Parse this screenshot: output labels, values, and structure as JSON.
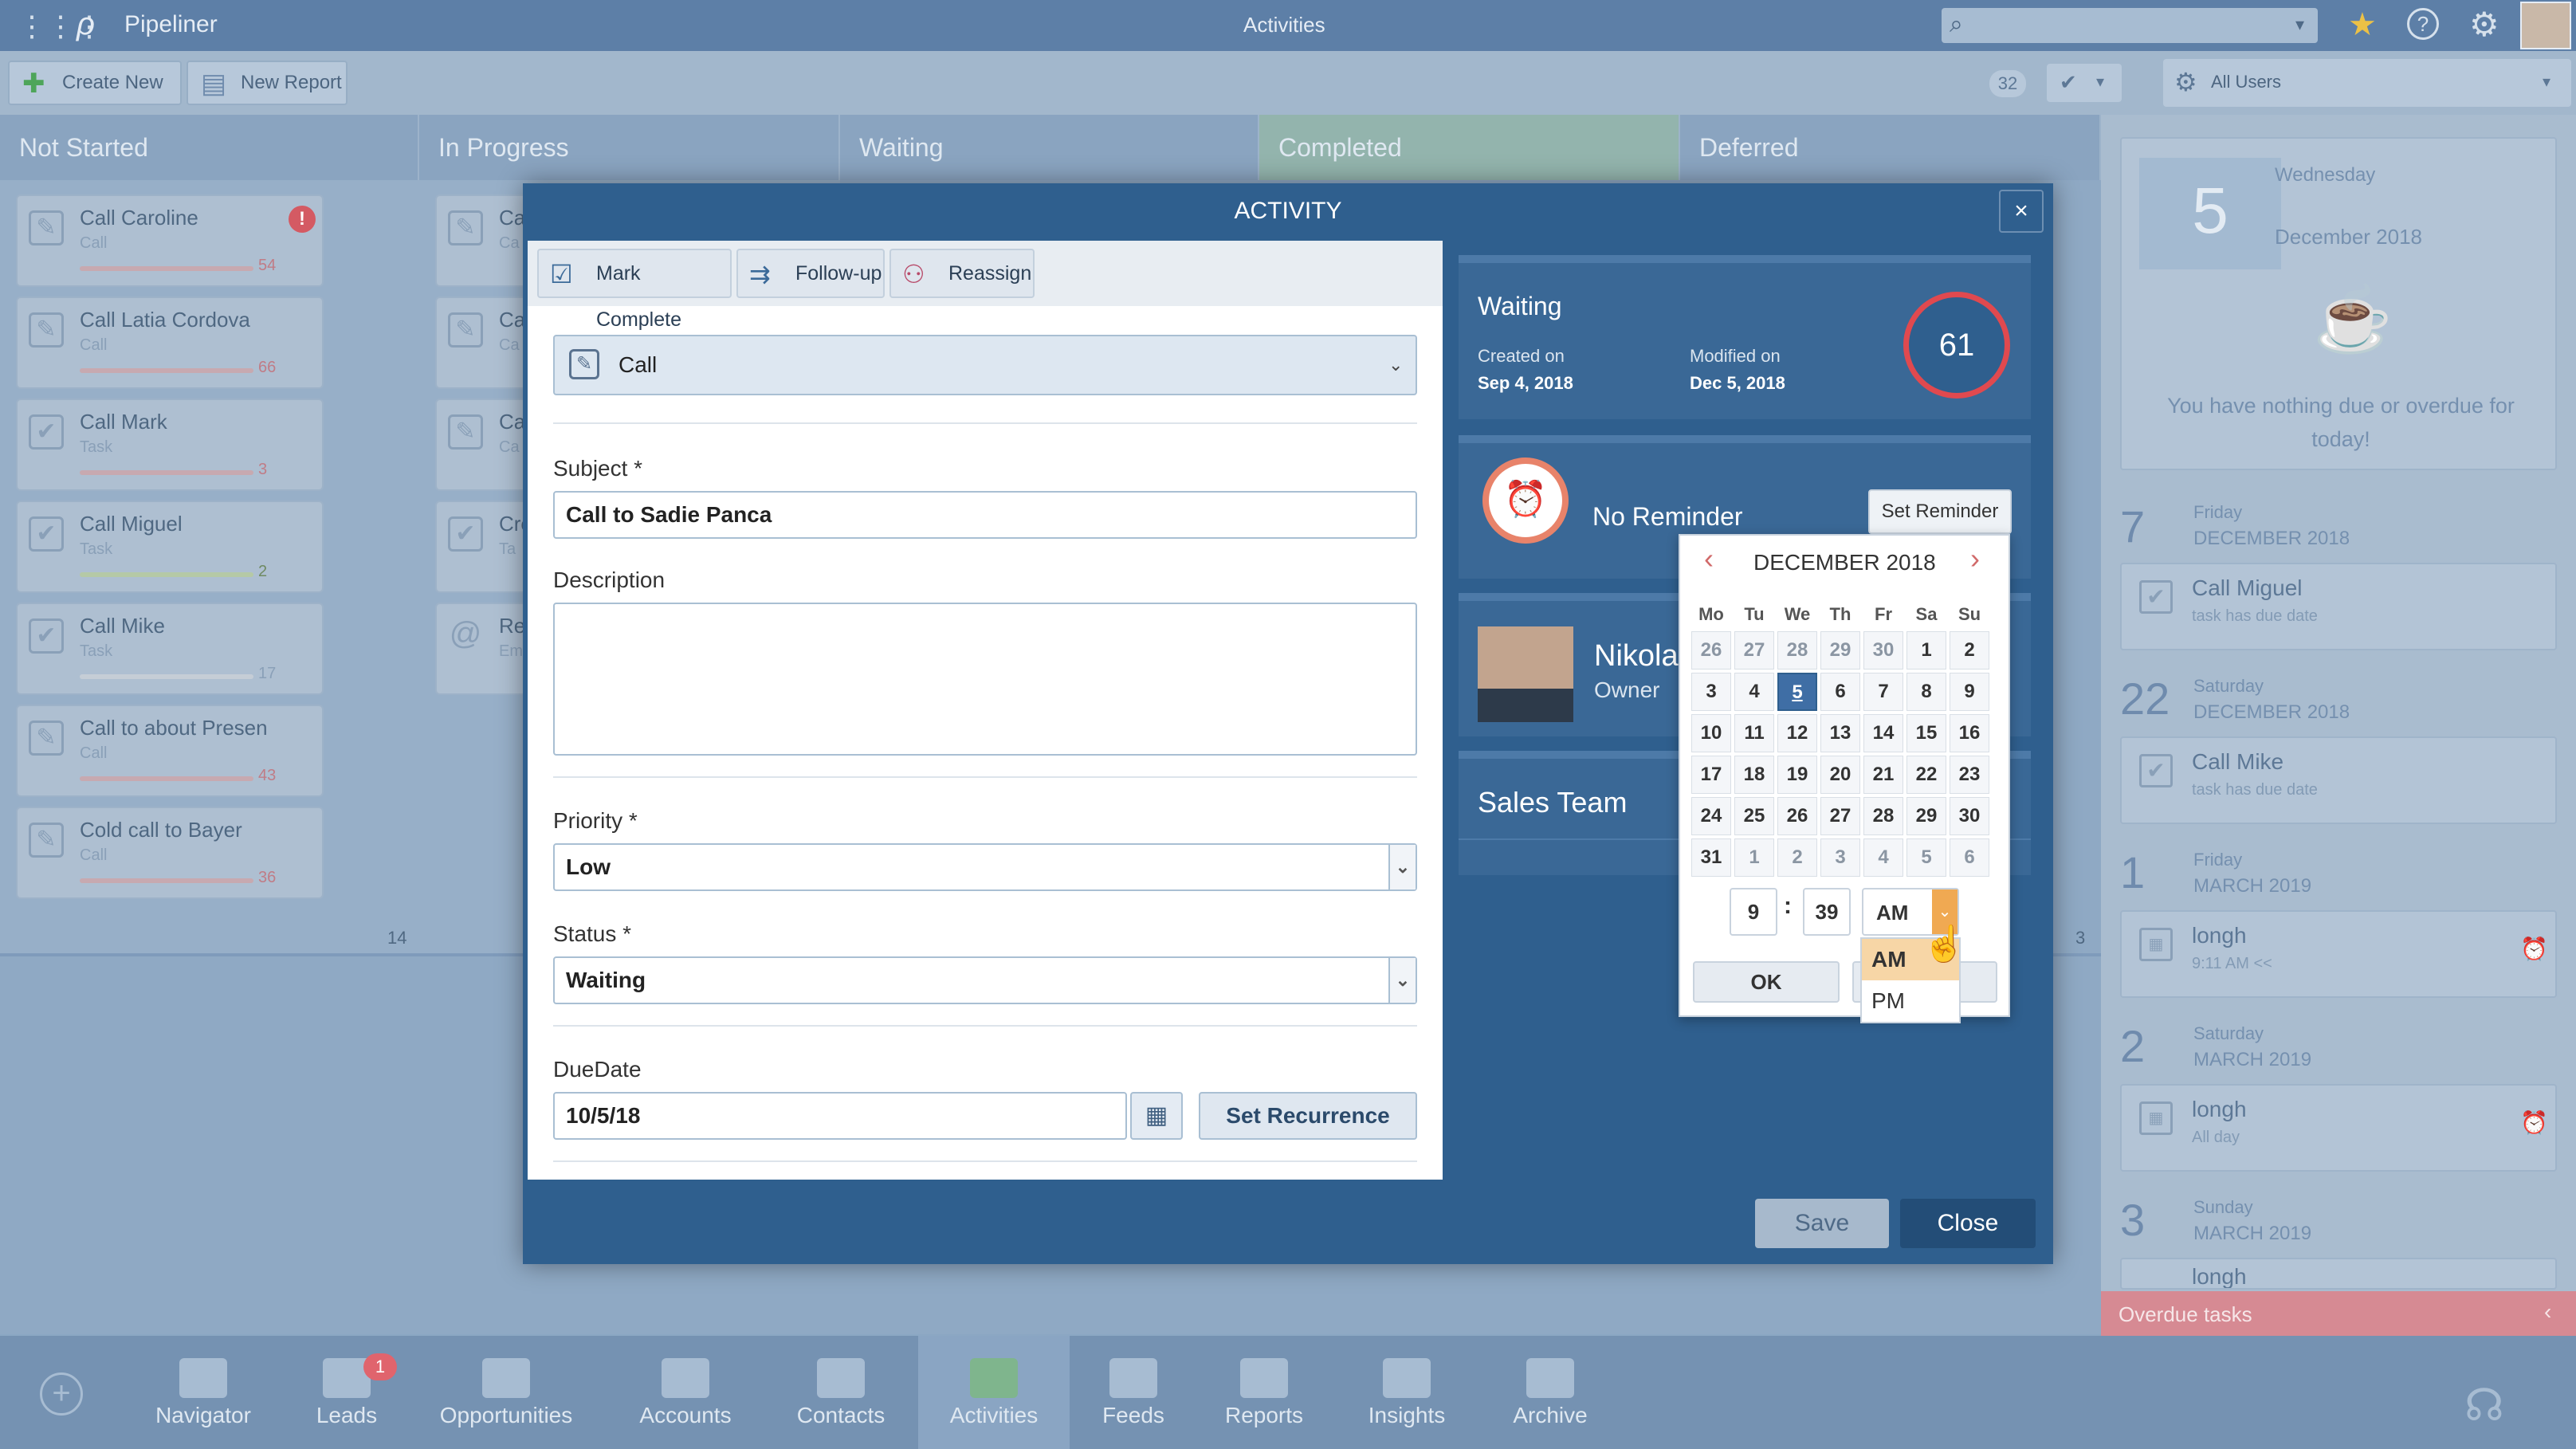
{
  "topbar": {
    "brand": "Pipeliner",
    "title": "Activities"
  },
  "toolbar": {
    "create_new": "Create New",
    "new_report": "New Report",
    "count": "32",
    "users_filter": "All Users"
  },
  "columns": [
    {
      "label": "Not Started"
    },
    {
      "label": "In Progress"
    },
    {
      "label": "Waiting"
    },
    {
      "label": "Completed"
    },
    {
      "label": "Deferred"
    }
  ],
  "not_started_cards": [
    {
      "title": "Call Caroline",
      "type": "Call",
      "num": "54"
    },
    {
      "title": "Call Latia Cordova",
      "type": "Call",
      "num": "66"
    },
    {
      "title": "Call Mark",
      "type": "Task",
      "num": "3"
    },
    {
      "title": "Call Miguel",
      "type": "Task",
      "num": "2"
    },
    {
      "title": "Call Mike",
      "type": "Task",
      "num": "17"
    },
    {
      "title": "Call to about Presen",
      "type": "Call",
      "num": "43"
    },
    {
      "title": "Cold call to Bayer",
      "type": "Call",
      "num": "36"
    }
  ],
  "in_progress_cards": [
    {
      "title": "Ca",
      "type": "Ca"
    },
    {
      "title": "Ca",
      "type": "Ca"
    },
    {
      "title": "Ca",
      "type": "Ca"
    },
    {
      "title": "Cre",
      "type": "Ta"
    },
    {
      "title": "Re",
      "type": "Em"
    }
  ],
  "column_counts": {
    "not_started": "14",
    "deferred": "3"
  },
  "modal": {
    "title": "ACTIVITY",
    "close_x": "×",
    "mark_complete": "Mark Complete",
    "follow_up": "Follow-up",
    "reassign": "Reassign",
    "type_value": "Call",
    "subject_label": "Subject *",
    "subject_value": "Call to Sadie Panca",
    "description_label": "Description",
    "priority_label": "Priority *",
    "priority_value": "Low",
    "status_label": "Status *",
    "status_value": "Waiting",
    "duedate_label": "DueDate",
    "duedate_value": "10/5/18",
    "set_recurrence": "Set Recurrence",
    "save": "Save",
    "close": "Close"
  },
  "status_panel": {
    "status": "Waiting",
    "created_label": "Created on",
    "created_value": "Sep 4, 2018",
    "modified_label": "Modified on",
    "modified_value": "Dec 5, 2018",
    "score": "61"
  },
  "reminder_panel": {
    "label": "No Reminder",
    "button": "Set Reminder"
  },
  "owner_panel": {
    "name": "Nikolau",
    "role": "Owner"
  },
  "team_panel": {
    "label": "Sales Team"
  },
  "calendar": {
    "month": "DECEMBER 2018",
    "prev": "‹",
    "next": "›",
    "weekdays": [
      "Mo",
      "Tu",
      "We",
      "Th",
      "Fr",
      "Sa",
      "Su"
    ],
    "weeks": [
      [
        "26",
        "27",
        "28",
        "29",
        "30",
        "1",
        "2"
      ],
      [
        "3",
        "4",
        "5",
        "6",
        "7",
        "8",
        "9"
      ],
      [
        "10",
        "11",
        "12",
        "13",
        "14",
        "15",
        "16"
      ],
      [
        "17",
        "18",
        "19",
        "20",
        "21",
        "22",
        "23"
      ],
      [
        "24",
        "25",
        "26",
        "27",
        "28",
        "29",
        "30"
      ],
      [
        "31",
        "1",
        "2",
        "3",
        "4",
        "5",
        "6"
      ]
    ],
    "selected": "5",
    "hour": "9",
    "minute": "39",
    "ampm": "AM",
    "options": [
      "AM",
      "PM"
    ],
    "ok": "OK"
  },
  "right_panel": {
    "today_num": "5",
    "today_weekday": "Wednesday",
    "today_month": "December 2018",
    "nothing_due": "You have nothing due or overdue for today!",
    "groups": [
      {
        "num": "7",
        "day": "Friday",
        "month": "DECEMBER 2018",
        "title": "Call Miguel",
        "sub": "task has due date"
      },
      {
        "num": "22",
        "day": "Saturday",
        "month": "DECEMBER 2018",
        "title": "Call Mike",
        "sub": "task has due date"
      },
      {
        "num": "1",
        "day": "Friday",
        "month": "MARCH 2019",
        "title": "longh",
        "sub": "9:11 AM <<"
      },
      {
        "num": "2",
        "day": "Saturday",
        "month": "MARCH 2019",
        "title": "longh",
        "sub": "All day"
      },
      {
        "num": "3",
        "day": "Sunday",
        "month": "MARCH 2019",
        "title": "longh",
        "sub": ""
      }
    ],
    "overdue": "Overdue tasks"
  },
  "bottom_nav": [
    {
      "label": "Navigator"
    },
    {
      "label": "Leads",
      "badge": "1"
    },
    {
      "label": "Opportunities"
    },
    {
      "label": "Accounts"
    },
    {
      "label": "Contacts"
    },
    {
      "label": "Activities"
    },
    {
      "label": "Feeds"
    },
    {
      "label": "Reports"
    },
    {
      "label": "Insights"
    },
    {
      "label": "Archive"
    }
  ],
  "colors": {
    "modal_bg": "#2f5f8e",
    "score_ring": "#e0494f",
    "selected_day": "#3f6ea5",
    "overdue": "#d68a93"
  }
}
